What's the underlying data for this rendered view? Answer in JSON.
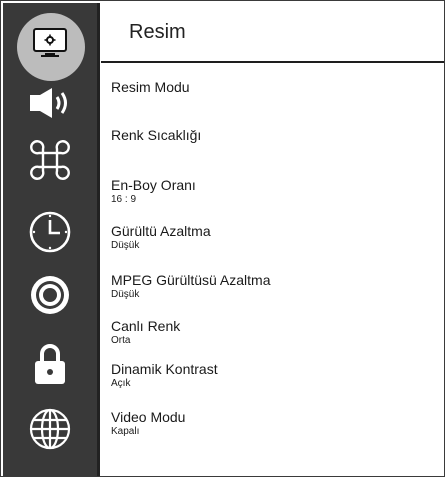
{
  "header": {
    "title": "Resim"
  },
  "sidebar": {
    "items": [
      {
        "icon": "monitor-icon",
        "active": true
      },
      {
        "icon": "speaker-icon",
        "active": false
      },
      {
        "icon": "command-icon",
        "active": false
      },
      {
        "icon": "clock-icon",
        "active": false
      },
      {
        "icon": "gear-icon",
        "active": false
      },
      {
        "icon": "lock-icon",
        "active": false
      },
      {
        "icon": "globe-icon",
        "active": false
      }
    ]
  },
  "menu": {
    "items": [
      {
        "label": "Resim Modu",
        "value": ""
      },
      {
        "label": "Renk Sıcaklığı",
        "value": ""
      },
      {
        "label": "En-Boy Oranı",
        "value": "16 : 9"
      },
      {
        "label": "Gürültü Azaltma",
        "value": "Düşük"
      },
      {
        "label": "MPEG Gürültüsü Azaltma",
        "value": "Düşük"
      },
      {
        "label": "Canlı Renk",
        "value": "Orta"
      },
      {
        "label": "Dinamik Kontrast",
        "value": "Açık"
      },
      {
        "label": "Video Modu",
        "value": "Kapalı"
      }
    ]
  },
  "colors": {
    "sidebar_bg": "#393939",
    "active_halo": "#bcbcbc",
    "icon": "#ffffff"
  }
}
